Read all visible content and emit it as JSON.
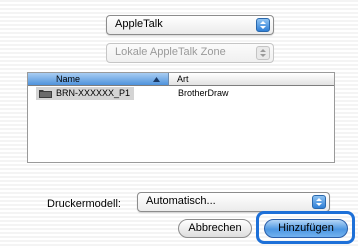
{
  "zone_type_popup": {
    "value": "AppleTalk"
  },
  "zone_popup": {
    "value": "Lokale AppleTalk Zone"
  },
  "printer_list": {
    "columns": {
      "name": "Name",
      "kind": "Art"
    },
    "rows": [
      {
        "name": "BRN-XXXXXX_P1",
        "kind": "BrotherDraw"
      }
    ]
  },
  "printer_model": {
    "label": "Druckermodell:",
    "value": "Automatisch..."
  },
  "buttons": {
    "cancel": "Abbrechen",
    "add": "Hinzufügen"
  },
  "colors": {
    "accent": "#1d70d8",
    "selection": "#d4d4d4"
  }
}
